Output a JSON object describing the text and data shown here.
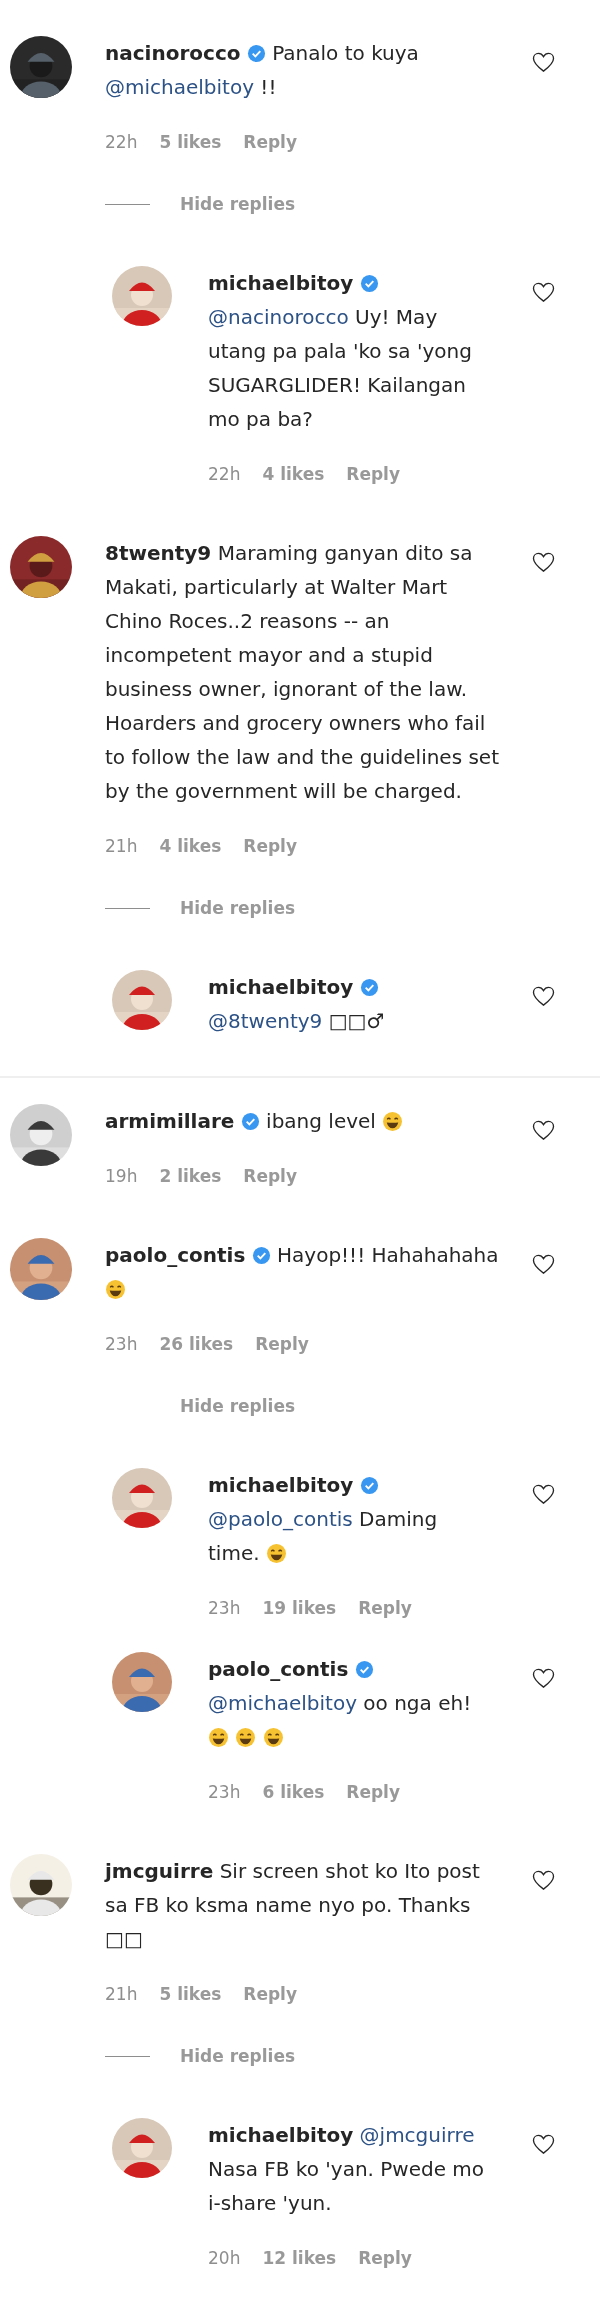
{
  "comments": [
    {
      "user": "nacinorocco",
      "verified": true,
      "divider_above": false,
      "body": [
        {
          "kind": "text",
          "text": "Panalo to kuya"
        },
        {
          "kind": "mention",
          "text": "@michaelbitoy"
        },
        {
          "kind": "text",
          "text": "!!"
        }
      ],
      "time": "22h",
      "likes": "5 likes",
      "reply_label": "Reply",
      "toggle": {
        "label": "Hide replies",
        "line": true
      },
      "replies": [
        {
          "user": "michaelbitoy",
          "verified": true,
          "body": [
            {
              "kind": "mention",
              "text": "@nacinorocco"
            },
            {
              "kind": "text",
              "text": "Uy! May utang pa pala 'ko sa 'yong SUGARGLIDER! Kailangan mo pa ba?"
            }
          ],
          "time": "22h",
          "likes": "4 likes",
          "reply_label": "Reply"
        }
      ]
    },
    {
      "user": "8twenty9",
      "verified": false,
      "divider_above": false,
      "body": [
        {
          "kind": "text",
          "text": "Maraming ganyan dito sa Makati, particularly at Walter Mart Chino Roces..2 reasons -- an incompetent mayor and a stupid business owner, ignorant of the law. Hoarders and grocery owners who fail to follow the law and the guidelines set by the government will be charged."
        }
      ],
      "time": "21h",
      "likes": "4 likes",
      "reply_label": "Reply",
      "toggle": {
        "label": "Hide replies",
        "line": true
      },
      "replies": [
        {
          "user": "michaelbitoy",
          "verified": true,
          "body": [
            {
              "kind": "mention",
              "text": "@8twenty9"
            },
            {
              "kind": "text",
              "text": "□□♂"
            }
          ]
        }
      ]
    },
    {
      "user": "armimillare",
      "verified": true,
      "divider_above": true,
      "body": [
        {
          "kind": "text",
          "text": "ibang level"
        },
        {
          "kind": "emoji"
        }
      ],
      "time": "19h",
      "likes": "2 likes",
      "reply_label": "Reply"
    },
    {
      "user": "paolo_contis",
      "verified": true,
      "divider_above": false,
      "body": [
        {
          "kind": "text",
          "text": "Hayop!!! Hahahahaha"
        },
        {
          "kind": "emoji"
        }
      ],
      "time": "23h",
      "likes": "26 likes",
      "reply_label": "Reply",
      "toggle": {
        "label": "Hide replies",
        "line": false
      },
      "replies": [
        {
          "user": "michaelbitoy",
          "verified": true,
          "body": [
            {
              "kind": "mention",
              "text": "@paolo_contis"
            },
            {
              "kind": "text",
              "text": "Daming time."
            },
            {
              "kind": "emoji"
            }
          ],
          "time": "23h",
          "likes": "19 likes",
          "reply_label": "Reply"
        },
        {
          "user": "paolo_contis",
          "verified": true,
          "body": [
            {
              "kind": "mention",
              "text": "@michaelbitoy"
            },
            {
              "kind": "text",
              "text": "oo nga eh!"
            },
            {
              "kind": "emoji"
            },
            {
              "kind": "emoji"
            },
            {
              "kind": "emoji"
            }
          ],
          "time": "23h",
          "likes": "6 likes",
          "reply_label": "Reply"
        }
      ]
    },
    {
      "user": "jmcguirre",
      "verified": false,
      "divider_above": false,
      "body": [
        {
          "kind": "text",
          "text": "Sir screen shot ko Ito post sa FB ko ksma name nyo po. Thanks □□"
        }
      ],
      "time": "21h",
      "likes": "5 likes",
      "reply_label": "Reply",
      "toggle": {
        "label": "Hide replies",
        "line": true
      },
      "replies": [
        {
          "user": "michaelbitoy",
          "verified": false,
          "body": [
            {
              "kind": "mention",
              "text": "@jmcguirre"
            },
            {
              "kind": "text",
              "text": "Nasa FB ko 'yan. Pwede mo i-share 'yun."
            }
          ],
          "time": "20h",
          "likes": "12 likes",
          "reply_label": "Reply"
        }
      ]
    }
  ]
}
